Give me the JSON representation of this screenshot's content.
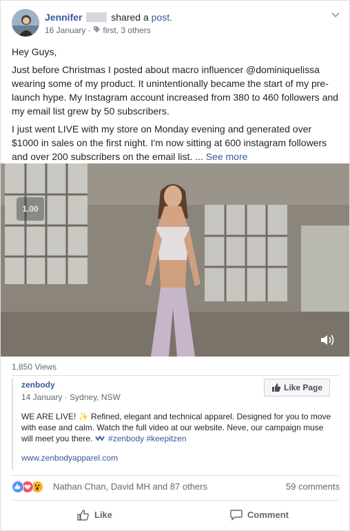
{
  "post": {
    "author": "Jennifer",
    "shared_text": "shared a",
    "shared_link": "post.",
    "date": "16 January",
    "audience": "first, 3 others",
    "body": [
      "Hey Guys,",
      "Just before Christmas I posted about macro influencer @dominiquelissa wearing some of my product. It unintentionally became the start of my pre-launch hype. My Instagram account increased from 380 to 460 followers and my email list grew by 50 subscribers.",
      "I just went LIVE with my store on Monday evening and generated over $1000 in sales on the first night. I'm now sitting at 600 instagram followers and over 200 subscribers on the email list. ..."
    ],
    "see_more": "See more"
  },
  "video": {
    "speed": "1.00",
    "views": "1,850 Views"
  },
  "shared_post": {
    "page_name": "zenbody",
    "meta": "14 January · Sydney, NSW",
    "like_page_label": "Like Page",
    "text": "WE ARE LIVE! ✨ Refined, elegant and technical apparel. Designed for you to move with ease and calm. Watch the full video at our website. Neve, our campaign muse will meet you there.",
    "tags": "#zenbody #keepitzen",
    "url": "www.zenbodyapparel.com"
  },
  "reactions": {
    "names": "Nathan Chan, David MH and 87 others",
    "comments": "59 comments"
  },
  "actions": {
    "like": "Like",
    "comment": "Comment"
  },
  "colors": {
    "link": "#365899",
    "like_reaction": "#5890ff",
    "love_reaction": "#f25268",
    "wow_reaction": "#f7b125"
  }
}
